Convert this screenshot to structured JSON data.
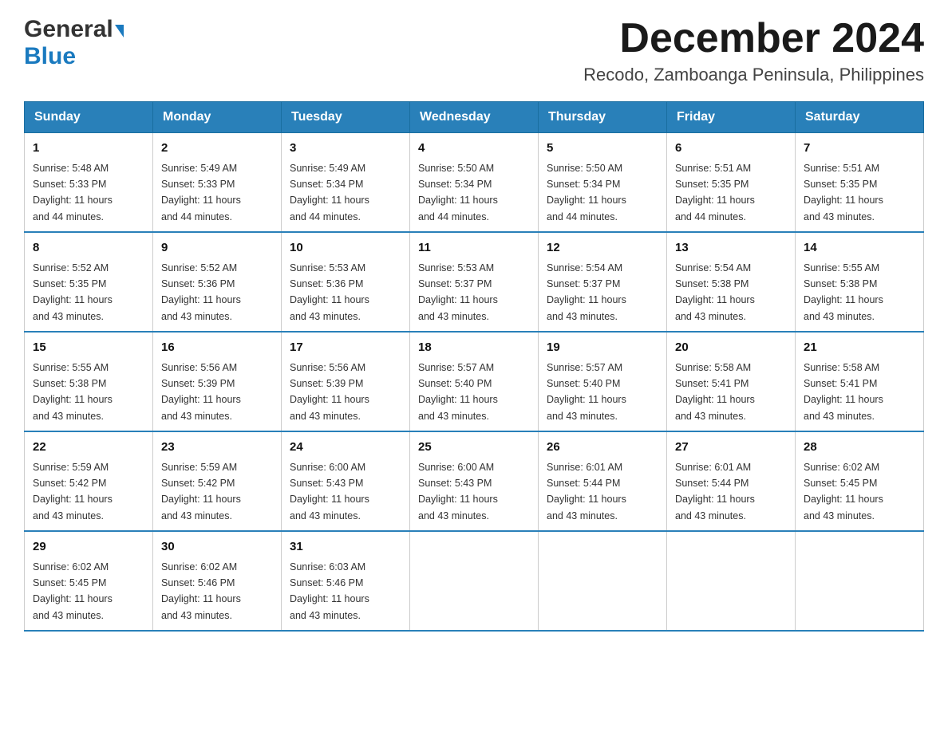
{
  "logo": {
    "line1": "General",
    "line2": "Blue"
  },
  "header": {
    "month_year": "December 2024",
    "location": "Recodo, Zamboanga Peninsula, Philippines"
  },
  "days_of_week": [
    "Sunday",
    "Monday",
    "Tuesday",
    "Wednesday",
    "Thursday",
    "Friday",
    "Saturday"
  ],
  "weeks": [
    [
      {
        "day": "1",
        "sunrise": "5:48 AM",
        "sunset": "5:33 PM",
        "daylight": "11 hours and 44 minutes."
      },
      {
        "day": "2",
        "sunrise": "5:49 AM",
        "sunset": "5:33 PM",
        "daylight": "11 hours and 44 minutes."
      },
      {
        "day": "3",
        "sunrise": "5:49 AM",
        "sunset": "5:34 PM",
        "daylight": "11 hours and 44 minutes."
      },
      {
        "day": "4",
        "sunrise": "5:50 AM",
        "sunset": "5:34 PM",
        "daylight": "11 hours and 44 minutes."
      },
      {
        "day": "5",
        "sunrise": "5:50 AM",
        "sunset": "5:34 PM",
        "daylight": "11 hours and 44 minutes."
      },
      {
        "day": "6",
        "sunrise": "5:51 AM",
        "sunset": "5:35 PM",
        "daylight": "11 hours and 44 minutes."
      },
      {
        "day": "7",
        "sunrise": "5:51 AM",
        "sunset": "5:35 PM",
        "daylight": "11 hours and 43 minutes."
      }
    ],
    [
      {
        "day": "8",
        "sunrise": "5:52 AM",
        "sunset": "5:35 PM",
        "daylight": "11 hours and 43 minutes."
      },
      {
        "day": "9",
        "sunrise": "5:52 AM",
        "sunset": "5:36 PM",
        "daylight": "11 hours and 43 minutes."
      },
      {
        "day": "10",
        "sunrise": "5:53 AM",
        "sunset": "5:36 PM",
        "daylight": "11 hours and 43 minutes."
      },
      {
        "day": "11",
        "sunrise": "5:53 AM",
        "sunset": "5:37 PM",
        "daylight": "11 hours and 43 minutes."
      },
      {
        "day": "12",
        "sunrise": "5:54 AM",
        "sunset": "5:37 PM",
        "daylight": "11 hours and 43 minutes."
      },
      {
        "day": "13",
        "sunrise": "5:54 AM",
        "sunset": "5:38 PM",
        "daylight": "11 hours and 43 minutes."
      },
      {
        "day": "14",
        "sunrise": "5:55 AM",
        "sunset": "5:38 PM",
        "daylight": "11 hours and 43 minutes."
      }
    ],
    [
      {
        "day": "15",
        "sunrise": "5:55 AM",
        "sunset": "5:38 PM",
        "daylight": "11 hours and 43 minutes."
      },
      {
        "day": "16",
        "sunrise": "5:56 AM",
        "sunset": "5:39 PM",
        "daylight": "11 hours and 43 minutes."
      },
      {
        "day": "17",
        "sunrise": "5:56 AM",
        "sunset": "5:39 PM",
        "daylight": "11 hours and 43 minutes."
      },
      {
        "day": "18",
        "sunrise": "5:57 AM",
        "sunset": "5:40 PM",
        "daylight": "11 hours and 43 minutes."
      },
      {
        "day": "19",
        "sunrise": "5:57 AM",
        "sunset": "5:40 PM",
        "daylight": "11 hours and 43 minutes."
      },
      {
        "day": "20",
        "sunrise": "5:58 AM",
        "sunset": "5:41 PM",
        "daylight": "11 hours and 43 minutes."
      },
      {
        "day": "21",
        "sunrise": "5:58 AM",
        "sunset": "5:41 PM",
        "daylight": "11 hours and 43 minutes."
      }
    ],
    [
      {
        "day": "22",
        "sunrise": "5:59 AM",
        "sunset": "5:42 PM",
        "daylight": "11 hours and 43 minutes."
      },
      {
        "day": "23",
        "sunrise": "5:59 AM",
        "sunset": "5:42 PM",
        "daylight": "11 hours and 43 minutes."
      },
      {
        "day": "24",
        "sunrise": "6:00 AM",
        "sunset": "5:43 PM",
        "daylight": "11 hours and 43 minutes."
      },
      {
        "day": "25",
        "sunrise": "6:00 AM",
        "sunset": "5:43 PM",
        "daylight": "11 hours and 43 minutes."
      },
      {
        "day": "26",
        "sunrise": "6:01 AM",
        "sunset": "5:44 PM",
        "daylight": "11 hours and 43 minutes."
      },
      {
        "day": "27",
        "sunrise": "6:01 AM",
        "sunset": "5:44 PM",
        "daylight": "11 hours and 43 minutes."
      },
      {
        "day": "28",
        "sunrise": "6:02 AM",
        "sunset": "5:45 PM",
        "daylight": "11 hours and 43 minutes."
      }
    ],
    [
      {
        "day": "29",
        "sunrise": "6:02 AM",
        "sunset": "5:45 PM",
        "daylight": "11 hours and 43 minutes."
      },
      {
        "day": "30",
        "sunrise": "6:02 AM",
        "sunset": "5:46 PM",
        "daylight": "11 hours and 43 minutes."
      },
      {
        "day": "31",
        "sunrise": "6:03 AM",
        "sunset": "5:46 PM",
        "daylight": "11 hours and 43 minutes."
      },
      null,
      null,
      null,
      null
    ]
  ],
  "labels": {
    "sunrise": "Sunrise:",
    "sunset": "Sunset:",
    "daylight": "Daylight:"
  }
}
